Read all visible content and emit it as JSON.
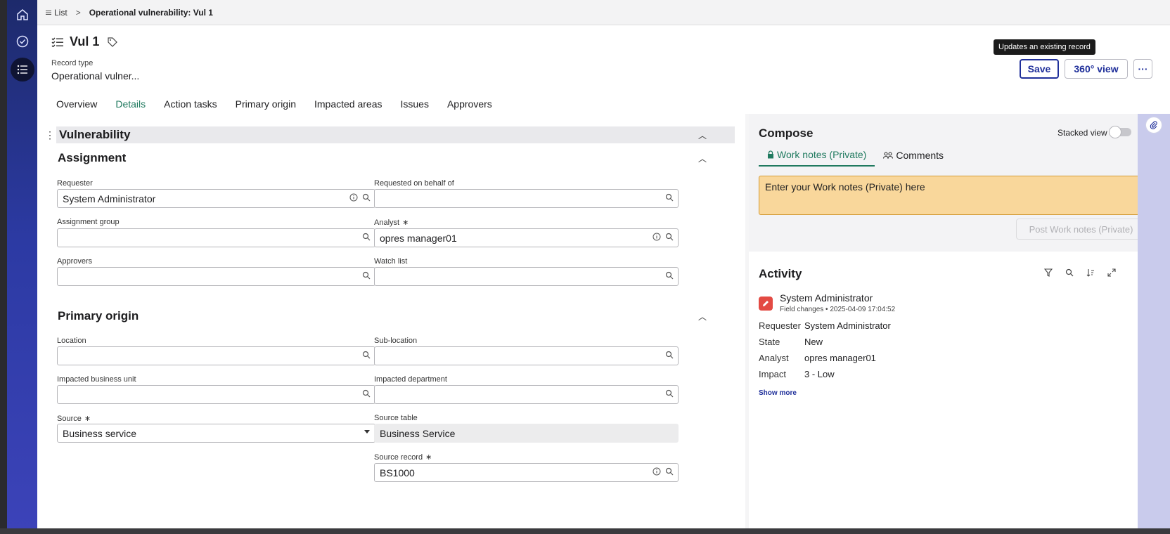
{
  "breadcrumb": {
    "list": "List",
    "current": "Operational vulnerability: Vul 1"
  },
  "record": {
    "title": "Vul 1",
    "record_type_label": "Record type",
    "record_type_value": "Operational vulner..."
  },
  "actions": {
    "tooltip": "Updates an existing record",
    "save": "Save",
    "view360": "360° view",
    "more": "···"
  },
  "tabs": [
    "Overview",
    "Details",
    "Action tasks",
    "Primary origin",
    "Impacted areas",
    "Issues",
    "Approvers"
  ],
  "section": {
    "title": "Vulnerability",
    "assignment_title": "Assignment",
    "origin_title": "Primary origin"
  },
  "fields": {
    "requester": {
      "label": "Requester",
      "value": "System Administrator"
    },
    "on_behalf": {
      "label": "Requested on behalf of",
      "value": ""
    },
    "assignment_group": {
      "label": "Assignment group",
      "value": ""
    },
    "analyst": {
      "label": "Analyst",
      "value": "opres manager01",
      "required": "∗"
    },
    "approvers": {
      "label": "Approvers",
      "value": ""
    },
    "watch_list": {
      "label": "Watch list",
      "value": ""
    },
    "location": {
      "label": "Location",
      "value": ""
    },
    "sub_location": {
      "label": "Sub-location",
      "value": ""
    },
    "business_unit": {
      "label": "Impacted business unit",
      "value": ""
    },
    "department": {
      "label": "Impacted department",
      "value": ""
    },
    "source": {
      "label": "Source",
      "value": "Business service",
      "required": "∗"
    },
    "source_table": {
      "label": "Source table",
      "value": "Business Service"
    },
    "source_record": {
      "label": "Source record",
      "value": "BS1000",
      "required": "∗"
    }
  },
  "compose": {
    "title": "Compose",
    "stacked_view": "Stacked view",
    "tab_work_notes": "Work notes (Private)",
    "tab_comments": "Comments",
    "placeholder": "Enter your Work notes (Private) here",
    "post_button": "Post Work notes (Private)"
  },
  "activity": {
    "title": "Activity",
    "entry": {
      "author": "System Administrator",
      "meta": "Field changes • 2025-04-09 17:04:52",
      "changes": [
        {
          "key": "Requester",
          "value": "System Administrator"
        },
        {
          "key": "State",
          "value": "New"
        },
        {
          "key": "Analyst",
          "value": "opres manager01"
        },
        {
          "key": "Impact",
          "value": "3 - Low"
        }
      ]
    },
    "show_more": "Show more"
  },
  "colors": {
    "accent": "#1f2f9a",
    "tab_active": "#207a5f",
    "work_notes_bg": "#f9d79b"
  }
}
